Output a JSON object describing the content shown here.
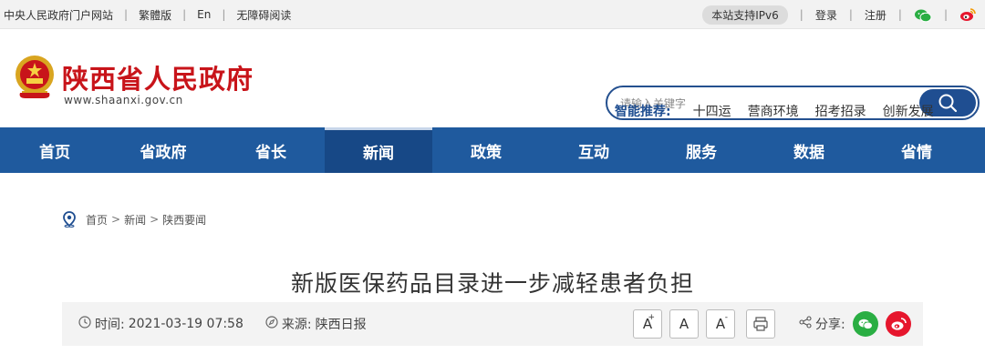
{
  "topbar": {
    "links": [
      "中央人民政府门户网站",
      "繁體版",
      "En",
      "无障碍阅读"
    ],
    "ipv6": "本站支持IPv6",
    "login": "登录",
    "register": "注册"
  },
  "header": {
    "site_title": "陕西省人民政府",
    "site_domain": "www.shaanxi.gov.cn",
    "search_placeholder": "请输入关键字",
    "smart_label": "智能推荐:",
    "smart_keywords": [
      "十四运",
      "营商环境",
      "招考招录",
      "创新发展"
    ]
  },
  "nav": {
    "items": [
      "首页",
      "省政府",
      "省长",
      "新闻",
      "政策",
      "互动",
      "服务",
      "数据",
      "省情"
    ],
    "active": "新闻"
  },
  "breadcrumb": {
    "items": [
      "首页",
      "新闻",
      "陕西要闻"
    ],
    "separator": ">"
  },
  "article": {
    "title": "新版医保药品目录进一步减轻患者负担",
    "time_label": "时间:",
    "time_value": "2021-03-19 07:58",
    "source_label": "来源:",
    "source_value": "陕西日报",
    "font_buttons": [
      "A",
      "A",
      "A"
    ],
    "share_label": "分享:"
  },
  "colors": {
    "nav_blue": "#1f5a9e",
    "title_red": "#c8141a",
    "wechat_green": "#2aae43",
    "weibo_red": "#e6162d"
  }
}
